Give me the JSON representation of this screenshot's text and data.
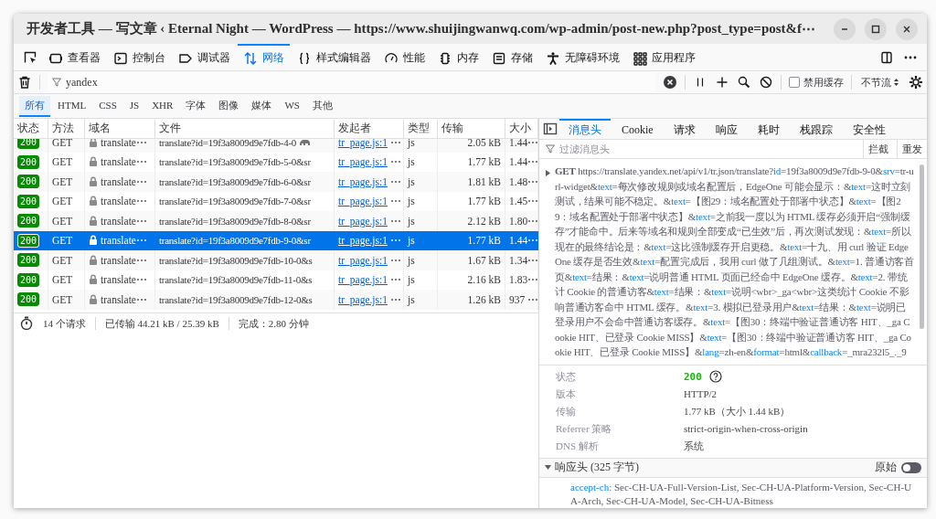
{
  "window": {
    "title": "开发者工具 — 写文章 ‹ Eternal Night — WordPress — https://www.shuijingwanwq.com/wp-admin/post-new.php?post_type=post&f⋯"
  },
  "tool_tabs": [
    {
      "label": "查看器",
      "selected": false
    },
    {
      "label": "控制台",
      "selected": false
    },
    {
      "label": "调试器",
      "selected": false
    },
    {
      "label": "网络",
      "selected": true
    },
    {
      "label": "样式编辑器",
      "selected": false
    },
    {
      "label": "性能",
      "selected": false
    },
    {
      "label": "内存",
      "selected": false
    },
    {
      "label": "存储",
      "selected": false
    },
    {
      "label": "无障碍环境",
      "selected": false
    },
    {
      "label": "应用程序",
      "selected": false
    }
  ],
  "filter": {
    "value": "yandex"
  },
  "disable_cache": {
    "label": "禁用缓存",
    "checked": false
  },
  "throttle": {
    "value": "不节流"
  },
  "type_filters": [
    {
      "label": "所有",
      "selected": true
    },
    {
      "label": "HTML",
      "selected": false
    },
    {
      "label": "CSS",
      "selected": false
    },
    {
      "label": "JS",
      "selected": false
    },
    {
      "label": "XHR",
      "selected": false
    },
    {
      "label": "字体",
      "selected": false
    },
    {
      "label": "图像",
      "selected": false
    },
    {
      "label": "媒体",
      "selected": false
    },
    {
      "label": "WS",
      "selected": false
    },
    {
      "label": "其他",
      "selected": false
    }
  ],
  "table": {
    "columns": [
      "状态",
      "方法",
      "域名",
      "文件",
      "发起者",
      "类型",
      "传输",
      "大小"
    ],
    "rows": [
      {
        "status": "200",
        "method": "GET",
        "domain": "translate⋯",
        "file": "translate?id=19f3a8009d9e7fdb-4-0",
        "tracker": true,
        "initiator": "tr_page.js:1",
        "initiator_more": "⋯",
        "type": "js",
        "transferred": "2.05 kB",
        "size": "1.44⋯",
        "selected": false
      },
      {
        "status": "200",
        "method": "GET",
        "domain": "translate⋯",
        "file": "translate?id=19f3a8009d9e7fdb-5-0&sr",
        "tracker": false,
        "initiator": "tr_page.js:1",
        "initiator_more": "⋯",
        "type": "js",
        "transferred": "1.77 kB",
        "size": "1.44⋯",
        "selected": false
      },
      {
        "status": "200",
        "method": "GET",
        "domain": "translate⋯",
        "file": "translate?id=19f3a8009d9e7fdb-6-0&sr",
        "tracker": false,
        "initiator": "tr_page.js:1",
        "initiator_more": "⋯",
        "type": "js",
        "transferred": "1.81 kB",
        "size": "1.48⋯",
        "selected": false
      },
      {
        "status": "200",
        "method": "GET",
        "domain": "translate⋯",
        "file": "translate?id=19f3a8009d9e7fdb-7-0&sr",
        "tracker": false,
        "initiator": "tr_page.js:1",
        "initiator_more": "⋯",
        "type": "js",
        "transferred": "1.77 kB",
        "size": "1.45⋯",
        "selected": false
      },
      {
        "status": "200",
        "method": "GET",
        "domain": "translate⋯",
        "file": "translate?id=19f3a8009d9e7fdb-8-0&sr",
        "tracker": false,
        "initiator": "tr_page.js:1",
        "initiator_more": "⋯",
        "type": "js",
        "transferred": "2.12 kB",
        "size": "1.80⋯",
        "selected": false
      },
      {
        "status": "200",
        "method": "GET",
        "domain": "translate⋯",
        "file": "translate?id=19f3a8009d9e7fdb-9-0&sr",
        "tracker": false,
        "initiator": "tr_page.js:1",
        "initiator_more": "⋯",
        "type": "js",
        "transferred": "1.77 kB",
        "size": "1.44⋯",
        "selected": true
      },
      {
        "status": "200",
        "method": "GET",
        "domain": "translate⋯",
        "file": "translate?id=19f3a8009d9e7fdb-10-0&s",
        "tracker": false,
        "initiator": "tr_page.js:1",
        "initiator_more": "⋯",
        "type": "js",
        "transferred": "1.67 kB",
        "size": "1.34⋯",
        "selected": false
      },
      {
        "status": "200",
        "method": "GET",
        "domain": "translate⋯",
        "file": "translate?id=19f3a8009d9e7fdb-11-0&s",
        "tracker": false,
        "initiator": "tr_page.js:1",
        "initiator_more": "⋯",
        "type": "js",
        "transferred": "2.16 kB",
        "size": "1.83⋯",
        "selected": false
      },
      {
        "status": "200",
        "method": "GET",
        "domain": "translate⋯",
        "file": "translate?id=19f3a8009d9e7fdb-12-0&s",
        "tracker": false,
        "initiator": "tr_page.js:1",
        "initiator_more": "⋯",
        "type": "js",
        "transferred": "1.26 kB",
        "size": "937 ⋯",
        "selected": false
      }
    ]
  },
  "summary": {
    "requests": "14 个请求",
    "transferred": "已传输 44.21 kB / 25.39 kB",
    "finish": "完成：2.80 分钟"
  },
  "details": {
    "tabs": [
      {
        "label": "消息头",
        "selected": true
      },
      {
        "label": "Cookie",
        "selected": false
      },
      {
        "label": "请求",
        "selected": false
      },
      {
        "label": "响应",
        "selected": false
      },
      {
        "label": "耗时",
        "selected": false
      },
      {
        "label": "栈跟踪",
        "selected": false
      },
      {
        "label": "安全性",
        "selected": false
      }
    ],
    "filter_placeholder": "过滤消息头",
    "actions": [
      "拦截",
      "重发"
    ],
    "request": {
      "expanded": false,
      "method": "GET",
      "url_parts": [
        {
          "kind": "plain",
          "text": "https://translate.yandex.net/api/v1/tr.json/translate?"
        },
        {
          "kind": "key",
          "text": "id"
        },
        {
          "kind": "plain",
          "text": "=19f3a8009d9e7fdb-9-0&"
        },
        {
          "kind": "key",
          "text": "srv"
        },
        {
          "kind": "plain",
          "text": "=tr-url-widget&"
        },
        {
          "kind": "key",
          "text": "text"
        },
        {
          "kind": "plain",
          "text": "=每次修改规则或域名配置后，EdgeOne 可能会显示：&"
        },
        {
          "kind": "key",
          "text": "text"
        },
        {
          "kind": "plain",
          "text": "=这时立刻测试，结果可能不稳定。&"
        },
        {
          "kind": "key",
          "text": "text"
        },
        {
          "kind": "plain",
          "text": "=【图29：域名配置处于部署中状态】&"
        },
        {
          "kind": "key",
          "text": "text"
        },
        {
          "kind": "plain",
          "text": "=【图29：域名配置处于部署中状态】&"
        },
        {
          "kind": "key",
          "text": "text"
        },
        {
          "kind": "plain",
          "text": "=之前我一度以为 HTML 缓存必须开启“强制缓存”才能命中。后来等域名和规则全部变成“已生效”后，再次测试发现：&"
        },
        {
          "kind": "key",
          "text": "text"
        },
        {
          "kind": "plain",
          "text": "=所以现在的最终结论是：&"
        },
        {
          "kind": "key",
          "text": "text"
        },
        {
          "kind": "plain",
          "text": "=这比强制缓存开启更稳。&"
        },
        {
          "kind": "key",
          "text": "text"
        },
        {
          "kind": "plain",
          "text": "=十九、用 curl 验证 EdgeOne 缓存是否生效&"
        },
        {
          "kind": "key",
          "text": "text"
        },
        {
          "kind": "plain",
          "text": "=配置完成后，我用 curl 做了几组测试。&"
        },
        {
          "kind": "key",
          "text": "text"
        },
        {
          "kind": "plain",
          "text": "=1. 普通访客首页&"
        },
        {
          "kind": "key",
          "text": "text"
        },
        {
          "kind": "plain",
          "text": "=结果：&"
        },
        {
          "kind": "key",
          "text": "text"
        },
        {
          "kind": "plain",
          "text": "=说明普通 HTML 页面已经命中 EdgeOne 缓存。&"
        },
        {
          "kind": "key",
          "text": "text"
        },
        {
          "kind": "plain",
          "text": "=2. 带统计 Cookie 的普通访客&"
        },
        {
          "kind": "key",
          "text": "text"
        },
        {
          "kind": "plain",
          "text": "=结果：&"
        },
        {
          "kind": "key",
          "text": "text"
        },
        {
          "kind": "plain",
          "text": "=说明<wbr>_ga<wbr>这类统计 Cookie 不影响普通访客命中 HTML 缓存。&"
        },
        {
          "kind": "key",
          "text": "text"
        },
        {
          "kind": "plain",
          "text": "=3. 模拟已登录用户&"
        },
        {
          "kind": "key",
          "text": "text"
        },
        {
          "kind": "plain",
          "text": "=结果：&"
        },
        {
          "kind": "key",
          "text": "text"
        },
        {
          "kind": "plain",
          "text": "=说明已登录用户不会命中普通访客缓存。&"
        },
        {
          "kind": "key",
          "text": "text"
        },
        {
          "kind": "plain",
          "text": "=【图30：终端中验证普通访客 HIT、_ga Cookie HIT、已登录 Cookie MISS】&"
        },
        {
          "kind": "key",
          "text": "text"
        },
        {
          "kind": "plain",
          "text": "=【图30：终端中验证普通访客 HIT、_ga Cookie HIT、已登录 Cookie MISS】&"
        },
        {
          "kind": "key",
          "text": "lang"
        },
        {
          "kind": "plain",
          "text": "=zh-en&"
        },
        {
          "kind": "key",
          "text": "format"
        },
        {
          "kind": "plain",
          "text": "=html&"
        },
        {
          "kind": "key",
          "text": "callback"
        },
        {
          "kind": "plain",
          "text": "=_mra232l5_._9"
        }
      ]
    },
    "fields": [
      {
        "label": "状态",
        "value": "200",
        "kind": "status"
      },
      {
        "label": "版本",
        "value": "HTTP/2",
        "kind": "text"
      },
      {
        "label": "传输",
        "value": "1.77 kB（大小 1.44 kB）",
        "kind": "text"
      },
      {
        "label": "Referrer 策略",
        "value": "strict-origin-when-cross-origin",
        "kind": "text"
      },
      {
        "label": "DNS 解析",
        "value": "系统",
        "kind": "text"
      }
    ],
    "response_headers": {
      "title": "响应头 (325 字节)",
      "expanded": true,
      "raw": {
        "label": "原始",
        "on": false
      },
      "headers": [
        {
          "name": "accept-ch:",
          "value": "Sec-CH-UA-Full-Version-List, Sec-CH-UA-Platform-Version, Sec-CH-UA-Arch, Sec-CH-UA-Model, Sec-CH-UA-Bitness"
        }
      ]
    }
  }
}
